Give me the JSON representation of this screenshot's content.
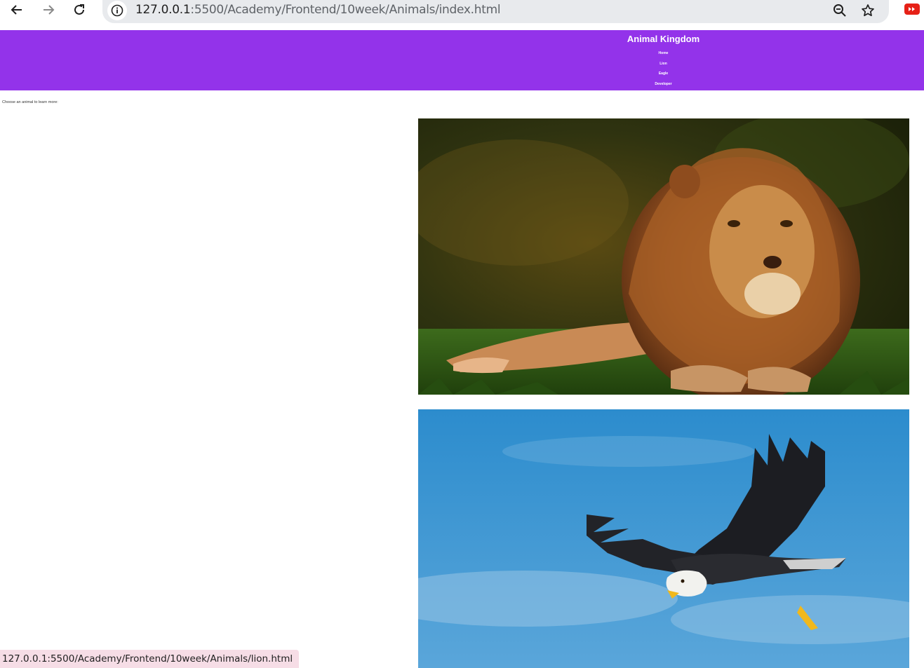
{
  "browser": {
    "url_host": "127.0.0.1",
    "url_path": ":5500/Academy/Frontend/10week/Animals/index.html",
    "back_icon": "arrow-left-icon",
    "forward_icon": "arrow-right-icon",
    "reload_icon": "reload-icon",
    "site_info_icon": "info-icon",
    "zoom_icon": "zoom-out-icon",
    "bookmark_icon": "star-icon",
    "extension_icon": "youtube-icon",
    "status_url": "127.0.0.1:5500/Academy/Frontend/10week/Animals/lion.html"
  },
  "site": {
    "title": "Animal Kingdom",
    "nav": [
      "Home",
      "Lion",
      "Eagle",
      "Developer"
    ],
    "intro": "Choose an animal to learn more:",
    "header_color": "#9333ea"
  },
  "images": [
    {
      "subject": "lion"
    },
    {
      "subject": "eagle"
    }
  ]
}
